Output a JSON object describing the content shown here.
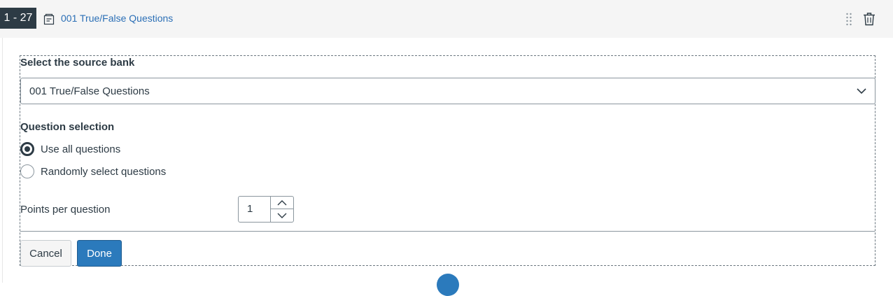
{
  "header": {
    "range": "1 - 27",
    "bank_link": "001 True/False Questions"
  },
  "source_bank": {
    "label": "Select the source bank",
    "selected": "001 True/False Questions"
  },
  "question_selection": {
    "label": "Question selection",
    "options": [
      {
        "label": "Use all questions",
        "checked": true
      },
      {
        "label": "Randomly select questions",
        "checked": false
      }
    ]
  },
  "points": {
    "label": "Points per question",
    "value": "1"
  },
  "actions": {
    "cancel_label": "Cancel",
    "done_label": "Done"
  },
  "colors": {
    "primary": "#2b7abc",
    "text": "#2d3b45",
    "link": "#2b6fb6",
    "badge": "#2d3b45"
  }
}
